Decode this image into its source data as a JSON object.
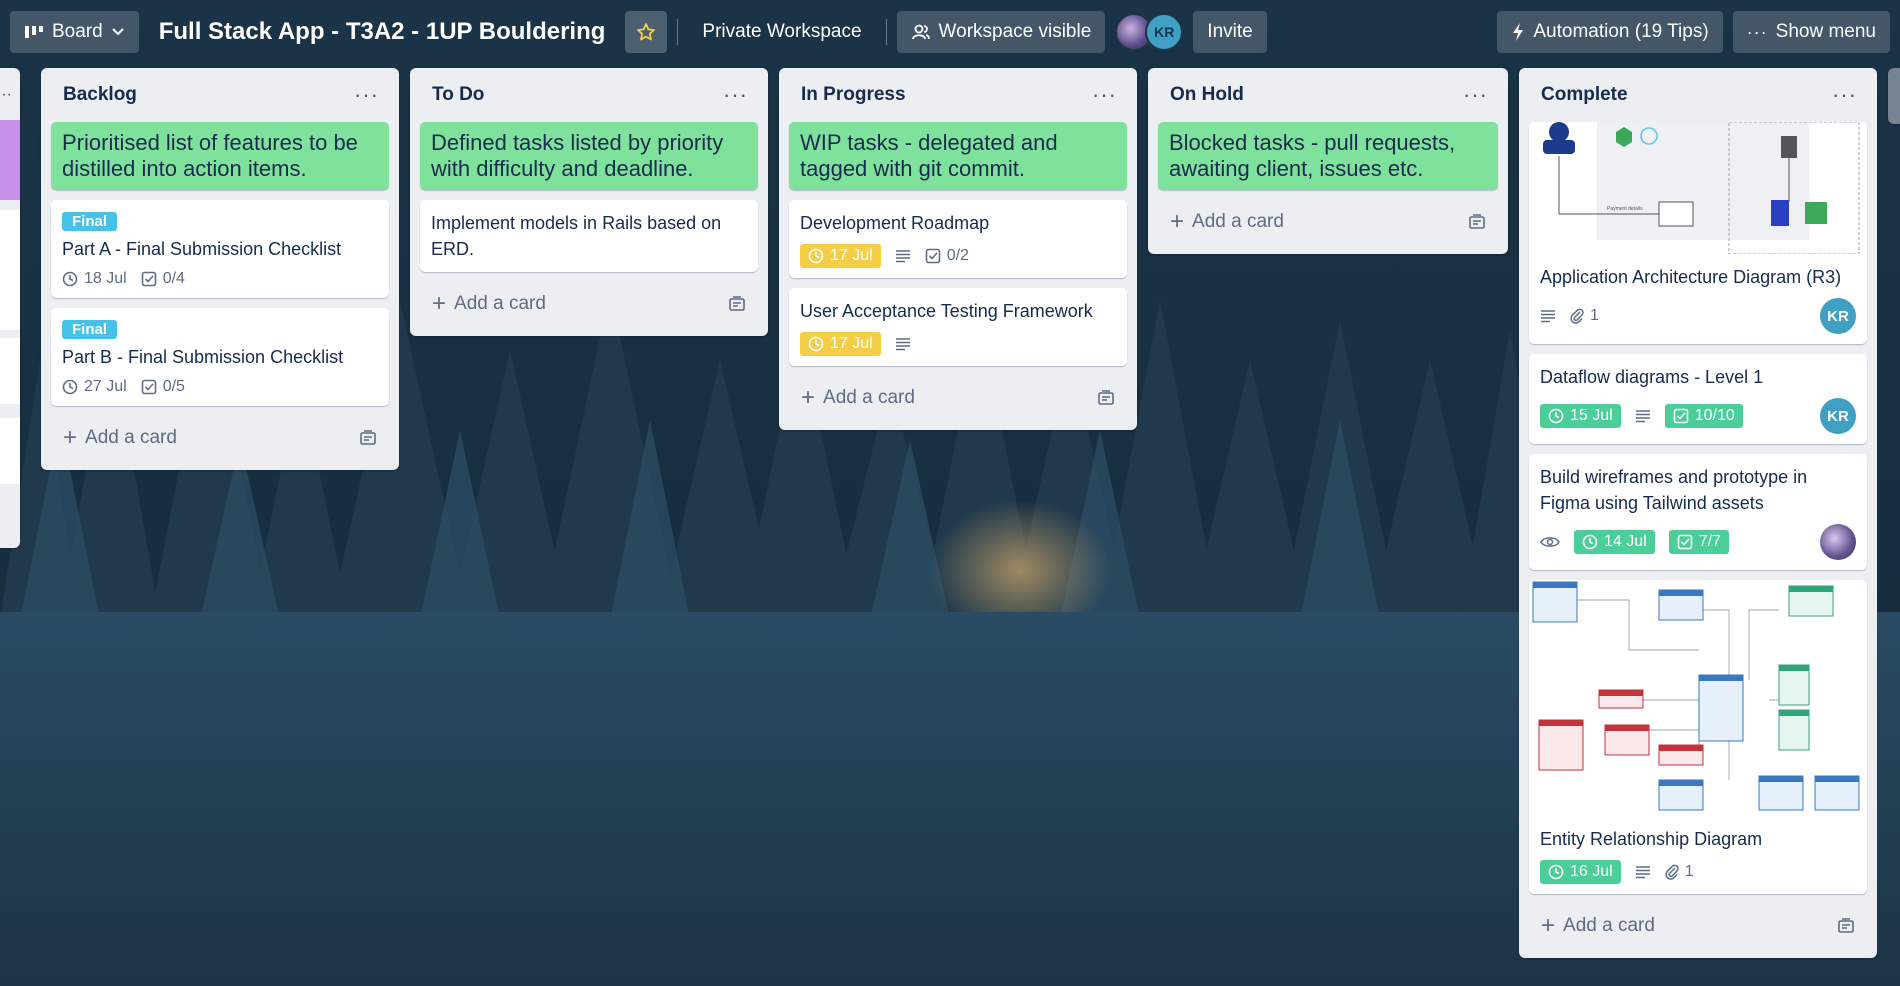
{
  "header": {
    "board_button": "Board",
    "board_title": "Full Stack App - T3A2 - 1UP Bouldering",
    "workspace": "Private Workspace",
    "visibility": "Workspace visible",
    "avatar_initials": "KR",
    "invite": "Invite",
    "automation": "Automation (19 Tips)",
    "show_menu": "Show menu"
  },
  "lists": {
    "backlog": {
      "title": "Backlog",
      "cards": [
        {
          "title": "Prioritised list of features to be distilled into action items."
        },
        {
          "label": "Final",
          "title": "Part A - Final Submission Checklist",
          "date": "18 Jul",
          "checklist": "0/4"
        },
        {
          "label": "Final",
          "title": "Part B - Final Submission Checklist",
          "date": "27 Jul",
          "checklist": "0/5"
        }
      ],
      "add": "Add a card"
    },
    "todo": {
      "title": "To Do",
      "cards": [
        {
          "title": "Defined tasks listed by priority with difficulty and deadline."
        },
        {
          "title": "Implement models in Rails based on ERD."
        }
      ],
      "add": "Add a card"
    },
    "inprogress": {
      "title": "In Progress",
      "cards": [
        {
          "title": "WIP tasks - delegated and tagged with git commit."
        },
        {
          "title": "Development Roadmap",
          "date": "17 Jul",
          "checklist": "0/2"
        },
        {
          "title": "User Acceptance Testing Framework",
          "date": "17 Jul"
        }
      ],
      "add": "Add a card"
    },
    "onhold": {
      "title": "On Hold",
      "cards": [
        {
          "title": "Blocked tasks - pull requests, awaiting client, issues etc."
        }
      ],
      "add": "Add a card"
    },
    "complete": {
      "title": "Complete",
      "cards": [
        {
          "title": "Application Architecture Diagram (R3)",
          "attachments": "1",
          "member": "KR"
        },
        {
          "title": "Dataflow diagrams - Level 1",
          "date": "15 Jul",
          "checklist": "10/10",
          "member": "KR"
        },
        {
          "title": "Build wireframes and prototype in Figma using Tailwind assets",
          "date": "14 Jul",
          "checklist": "7/7"
        },
        {
          "title": "Entity Relationship Diagram",
          "date": "16 Jul",
          "attachments": "1"
        }
      ],
      "add": "Add a card"
    }
  },
  "colors": {
    "green_card": "#7ee29c",
    "label_final": "#46c2e8",
    "due_yellow": "#f5cd47",
    "due_green": "#4bce97",
    "list_bg": "#eceef2"
  }
}
